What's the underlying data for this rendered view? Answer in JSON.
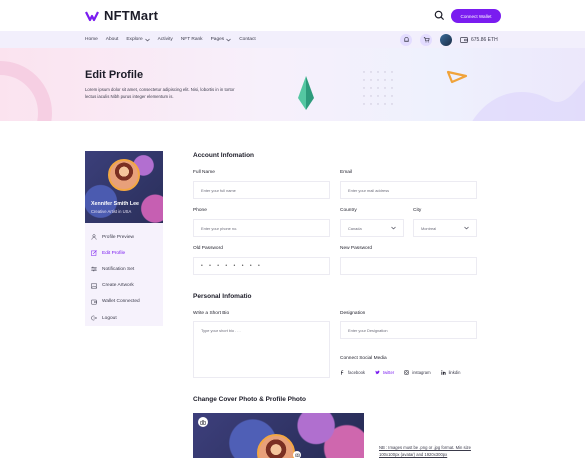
{
  "brand": {
    "name": "NFTMart",
    "accent": "#7a1cf0"
  },
  "header": {
    "connect_label": "Connect Wallet",
    "nav": [
      {
        "label": "Home",
        "dropdown": false
      },
      {
        "label": "About",
        "dropdown": false
      },
      {
        "label": "Explore",
        "dropdown": true
      },
      {
        "label": "Activity",
        "dropdown": false
      },
      {
        "label": "NFT Rank",
        "dropdown": false
      },
      {
        "label": "Pages",
        "dropdown": true
      },
      {
        "label": "Contact",
        "dropdown": false
      }
    ],
    "wallet_balance": "675.86 ETH",
    "icons": [
      "search-icon",
      "bell-icon",
      "cart-icon",
      "wallet-icon"
    ]
  },
  "banner": {
    "title": "Edit Profile",
    "subtitle": "Lorem ipsum dolor sit amet, consectetur adipiscing elit. Nisi, lobortis in in tortor lectus iaculis Nibh purus integer elementum is."
  },
  "sidebar": {
    "name": "Xennifer Smith Lee",
    "role": "Creative Artist in USA",
    "items": [
      {
        "label": "Profile Preview",
        "icon": "user-icon",
        "active": false
      },
      {
        "label": "Edit Profile",
        "icon": "edit-icon",
        "active": true
      },
      {
        "label": "Notification Set",
        "icon": "sliders-icon",
        "active": false
      },
      {
        "label": "Create Artwork",
        "icon": "image-icon",
        "active": false
      },
      {
        "label": "Wallet Connected",
        "icon": "wallet-icon",
        "active": false
      },
      {
        "label": "Logout",
        "icon": "logout-icon",
        "active": false
      }
    ]
  },
  "account": {
    "title": "Account Infomation",
    "full_name_label": "Full Name",
    "full_name_placeholder": "Enter your full name",
    "email_label": "Email",
    "email_placeholder": "Enter your mail address",
    "phone_label": "Phone",
    "phone_placeholder": "Enter your phone no.",
    "country_label": "Country",
    "country_value": "Canada",
    "city_label": "City",
    "city_value": "Montreal",
    "old_password_label": "Old Password",
    "old_password_value": "• • • • • • • •",
    "new_password_label": "New Password",
    "new_password_value": ""
  },
  "personal": {
    "title": "Personal Infomatio",
    "bio_label": "Write  a Short Bio",
    "bio_placeholder": "Type your short bio . . .",
    "designation_label": "Designation",
    "designation_placeholder": "Enter your Designation",
    "social_label": "Connect Social Media",
    "social": [
      {
        "label": "facebook",
        "icon": "facebook-icon"
      },
      {
        "label": "twitter",
        "icon": "twitter-icon",
        "active": true
      },
      {
        "label": "instagram",
        "icon": "instagram-icon"
      },
      {
        "label": "linkdin",
        "icon": "linkedin-icon"
      }
    ]
  },
  "cover": {
    "title": "Change Cover Photo & Profile Photo",
    "note": "NB : Images must be .png or .jpg format. Min size 100x100px (avatar) and 1920x300px"
  }
}
